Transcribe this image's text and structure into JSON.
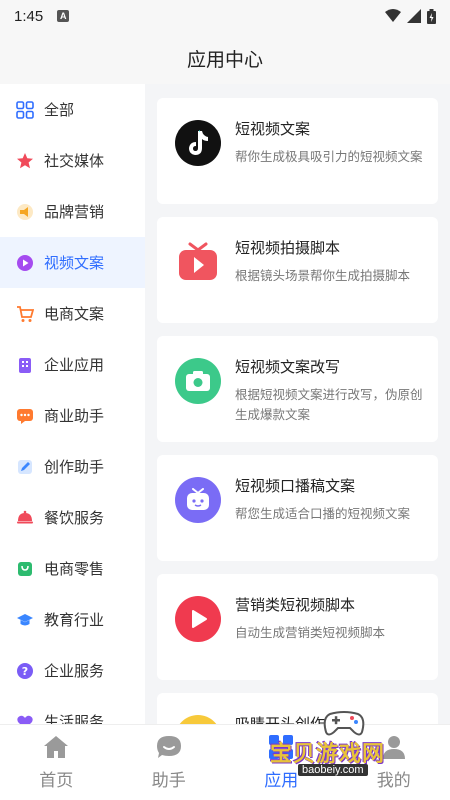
{
  "status_bar": {
    "time": "1:45",
    "notif_letter": "A"
  },
  "header": {
    "title": "应用中心"
  },
  "sidebar": {
    "items": [
      {
        "label": "全部",
        "icon": "grid-icon",
        "color": "#2f6dff"
      },
      {
        "label": "社交媒体",
        "icon": "star-icon",
        "color": "#f04a5a"
      },
      {
        "label": "品牌营销",
        "icon": "megaphone-icon",
        "color": "#f5a623"
      },
      {
        "label": "视频文案",
        "icon": "play-icon",
        "color": "#a54bf0",
        "active": true
      },
      {
        "label": "电商文案",
        "icon": "cart-icon",
        "color": "#ff7a2f"
      },
      {
        "label": "企业应用",
        "icon": "building-icon",
        "color": "#8a5cf6"
      },
      {
        "label": "商业助手",
        "icon": "chat-icon",
        "color": "#ff7a2f"
      },
      {
        "label": "创作助手",
        "icon": "pen-icon",
        "color": "#3a86ff"
      },
      {
        "label": "餐饮服务",
        "icon": "dish-icon",
        "color": "#f04a5a"
      },
      {
        "label": "电商零售",
        "icon": "bag-icon",
        "color": "#2dbb6f"
      },
      {
        "label": "教育行业",
        "icon": "graduation-cap-icon",
        "color": "#3a86ff"
      },
      {
        "label": "企业服务",
        "icon": "question-icon",
        "color": "#7a5cf6"
      },
      {
        "label": "生活服务",
        "icon": "heart-icon",
        "color": "#8a5cf6"
      }
    ]
  },
  "cards": [
    {
      "title": "短视频文案",
      "desc": "帮你生成极具吸引力的短视频文案",
      "icon": "tiktok-icon",
      "color": "#111111"
    },
    {
      "title": "短视频拍摄脚本",
      "desc": "根据镜头场景帮你生成拍摄脚本",
      "icon": "tv-play-icon",
      "color": "#f0555f"
    },
    {
      "title": "短视频文案改写",
      "desc": "根据短视频文案进行改写，伪原创生成爆款文案",
      "icon": "camera-icon",
      "color": "#3cc98a"
    },
    {
      "title": "短视频口播稿文案",
      "desc": "帮您生成适合口播的短视频文案",
      "icon": "tv-icon",
      "color": "#7a6cf5"
    },
    {
      "title": "营销类短视频脚本",
      "desc": "自动生成营销类短视频脚本",
      "icon": "play-circle-icon",
      "color": "#f03a4f"
    },
    {
      "title": "吸睛开头创作",
      "desc": "",
      "icon": "sun-icon",
      "color": "#f7c93a"
    }
  ],
  "tabbar": {
    "tabs": [
      {
        "label": "首页",
        "icon": "home-icon"
      },
      {
        "label": "助手",
        "icon": "chat-bubble-icon"
      },
      {
        "label": "应用",
        "icon": "apps-icon",
        "active": true
      },
      {
        "label": "我的",
        "icon": "user-icon"
      }
    ]
  },
  "watermark": {
    "text": "宝贝游戏网",
    "url": "baobeiy.com"
  }
}
